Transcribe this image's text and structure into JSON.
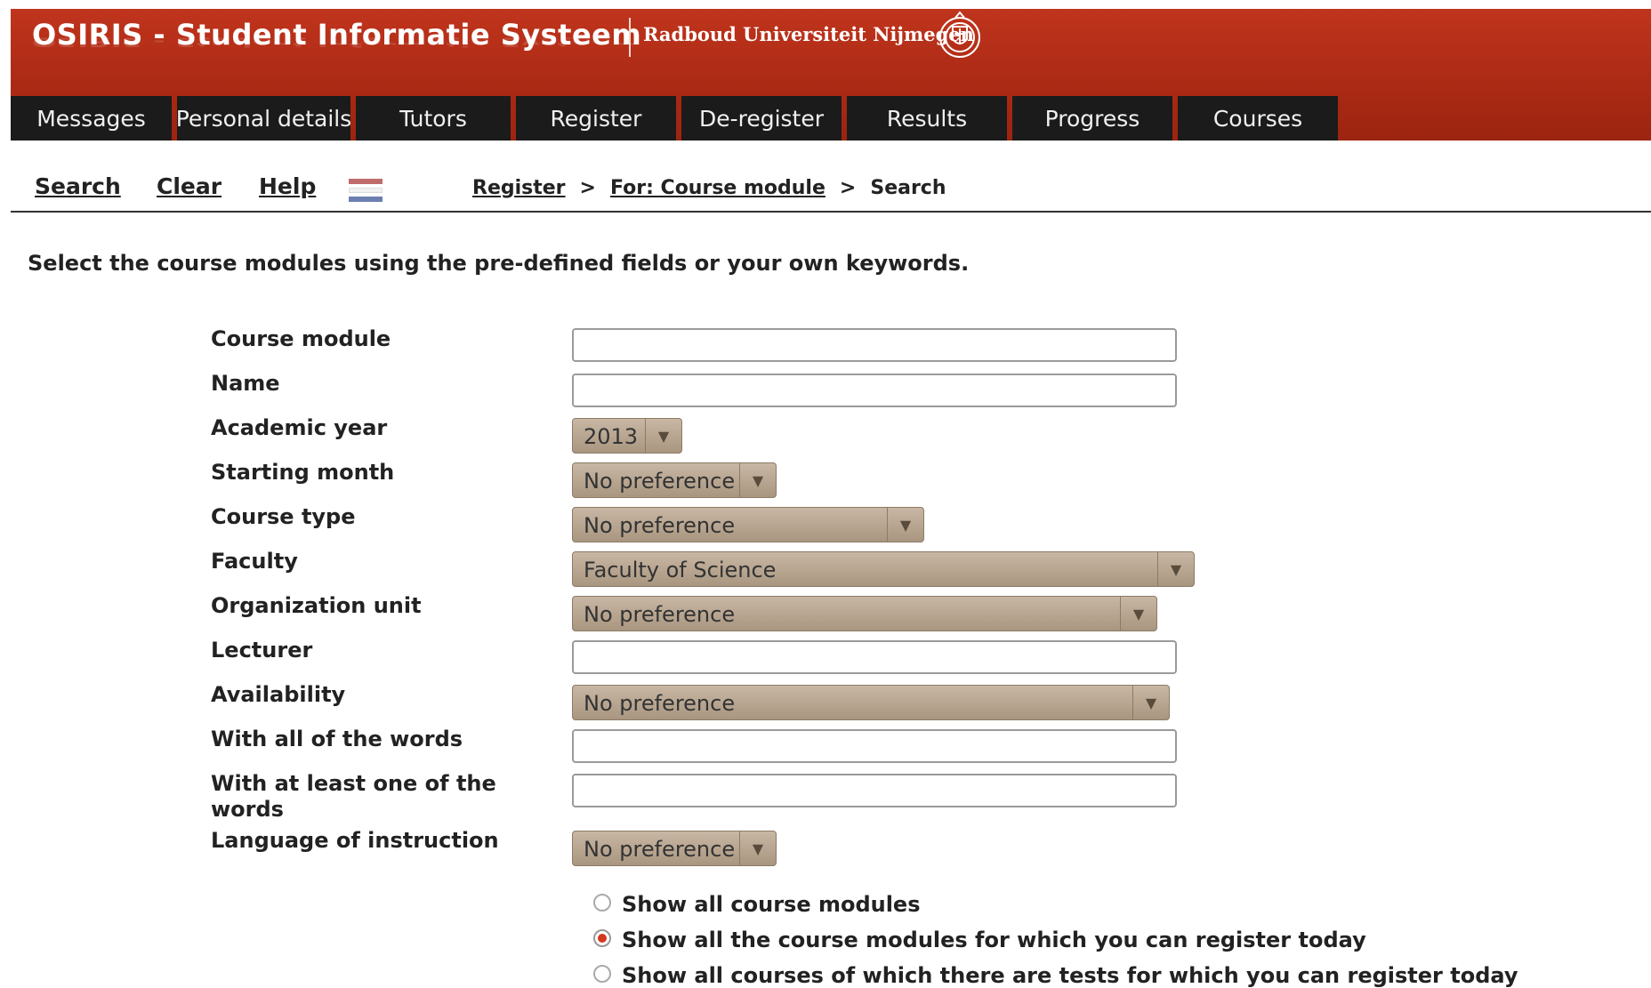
{
  "header": {
    "app_title": "OSIRIS - Student Informatie Systeem",
    "university": "Radboud Universiteit Nijmegen",
    "seal_icon": "radboud-seal-icon"
  },
  "nav": {
    "tabs": [
      "Messages",
      "Personal details",
      "Tutors",
      "Register",
      "De-register",
      "Results",
      "Progress",
      "Courses"
    ]
  },
  "toolbar": {
    "search": "Search",
    "clear": "Clear",
    "help": "Help",
    "flag_icon": "dutch-flag-icon"
  },
  "breadcrumb": {
    "register": "Register",
    "sep": ">",
    "for_course_module": "For: Course module",
    "current": "Search"
  },
  "instruction": "Select the course modules using the pre-defined fields or your own keywords.",
  "form": {
    "course_module": {
      "label": "Course module",
      "value": ""
    },
    "name": {
      "label": "Name",
      "value": ""
    },
    "academic_year": {
      "label": "Academic year",
      "value": "2013"
    },
    "starting_month": {
      "label": "Starting month",
      "value": "No preference"
    },
    "course_type": {
      "label": "Course type",
      "value": "No preference"
    },
    "faculty": {
      "label": "Faculty",
      "value": "Faculty of Science"
    },
    "organization_unit": {
      "label": "Organization unit",
      "value": "No preference"
    },
    "lecturer": {
      "label": "Lecturer",
      "value": ""
    },
    "availability": {
      "label": "Availability",
      "value": "No preference"
    },
    "all_words": {
      "label": "With all of the words",
      "value": ""
    },
    "one_word": {
      "label": "With at least one of the words",
      "value": ""
    },
    "language": {
      "label": "Language of instruction",
      "value": "No preference"
    }
  },
  "options": {
    "show_all": "Show all course modules",
    "show_register_today": "Show all the course modules for which you can register today",
    "show_tests_today": "Show all courses of which there are tests for which you can register today",
    "selected": "show_register_today"
  },
  "colors": {
    "header_red": "#b02c16",
    "tab_bg": "#1b1b1b",
    "select_bg": "#b8a690",
    "radio_selected": "#d4381c"
  }
}
